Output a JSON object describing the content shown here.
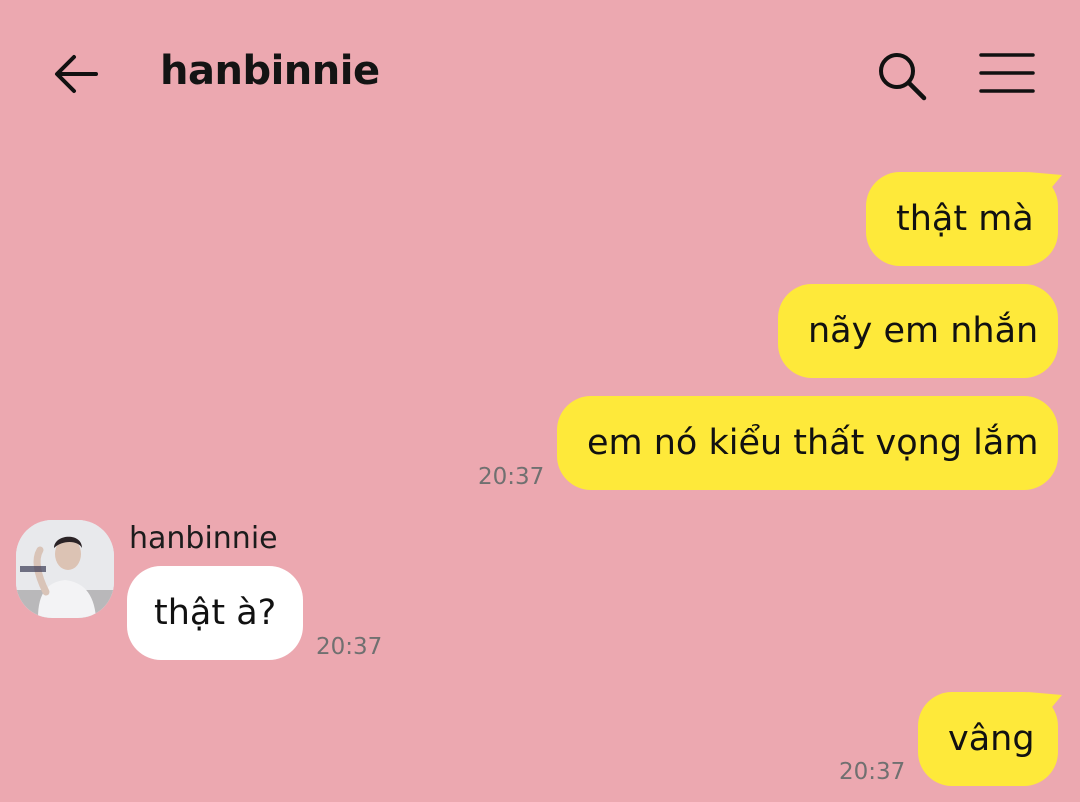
{
  "header": {
    "title": "hanbinnie",
    "back_icon": "arrow-left-icon",
    "search_icon": "search-icon",
    "menu_icon": "hamburger-menu-icon"
  },
  "messages": {
    "m1": {
      "text": "thật mà"
    },
    "m2": {
      "text": "nãy em nhắn"
    },
    "m3": {
      "text": "em nó kiểu thất vọng lắm",
      "time": "20:37"
    },
    "m4": {
      "sender": "hanbinnie",
      "text": "thật à?",
      "time": "20:37"
    },
    "m5": {
      "text": "vâng",
      "time": "20:37"
    }
  },
  "colors": {
    "background": "#eca8b0",
    "outgoing_bubble": "#fee93a",
    "incoming_bubble": "#ffffff"
  }
}
